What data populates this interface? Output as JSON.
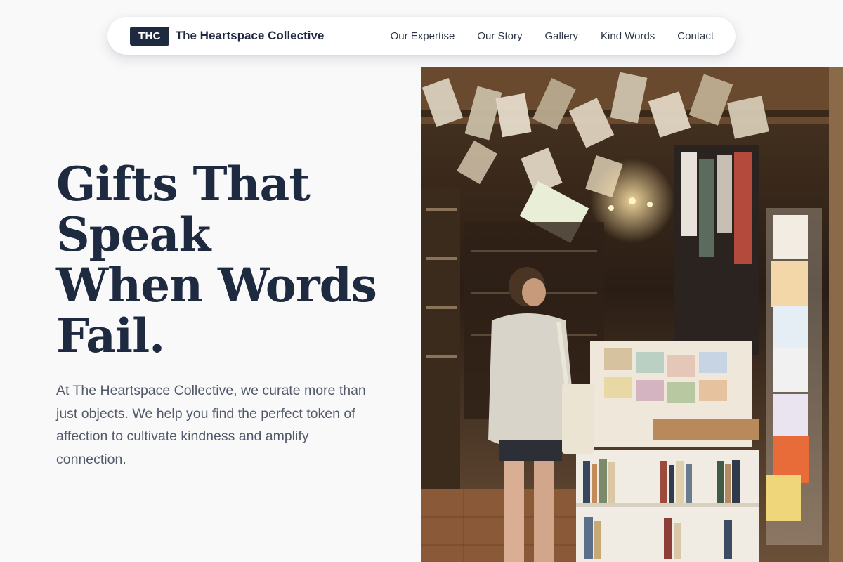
{
  "header": {
    "logo_badge": "THC",
    "brand_name": "The Heartspace Collective",
    "nav": [
      {
        "label": "Our Expertise"
      },
      {
        "label": "Our Story"
      },
      {
        "label": "Gallery"
      },
      {
        "label": "Kind Words"
      },
      {
        "label": "Contact"
      }
    ]
  },
  "hero": {
    "title_lines": [
      "Gifts That",
      "Speak",
      "When Words",
      "Fail."
    ],
    "description": "At The Heartspace Collective, we curate more than just objects. We help you find the perfect token of affection to cultivate kindness and amplify connection.",
    "image_subject": "bookshop-interior-photo"
  },
  "colors": {
    "brand_navy": "#1e2a40",
    "background": "#f9f9fa",
    "body_text": "#525a6a"
  }
}
